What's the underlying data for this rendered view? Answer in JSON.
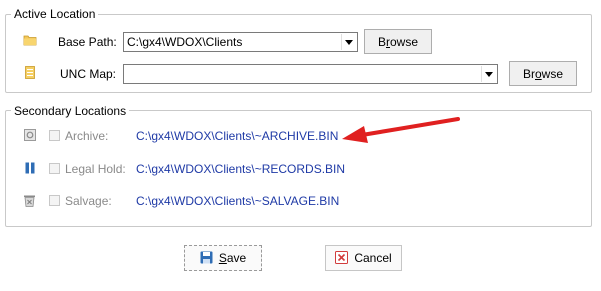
{
  "active_location": {
    "title": "Active Location",
    "base_path_label": "Base Path:",
    "base_path_value": "C:\\gx4\\WDOX\\Clients",
    "unc_map_label": "UNC Map:",
    "unc_map_value": "",
    "browse_prefix": "B",
    "browse_underlined": "r",
    "browse_suffix": "owse",
    "browse2_prefix": "Br",
    "browse2_underlined": "o",
    "browse2_suffix": "wse"
  },
  "secondary_locations": {
    "title": "Secondary Locations",
    "items": [
      {
        "label": "Archive:",
        "path": "C:\\gx4\\WDOX\\Clients\\~ARCHIVE.BIN",
        "checked": false,
        "icon": "archive-icon"
      },
      {
        "label": "Legal Hold:",
        "path": "C:\\gx4\\WDOX\\Clients\\~RECORDS.BIN",
        "checked": false,
        "icon": "legal-hold-icon"
      },
      {
        "label": "Salvage:",
        "path": "C:\\gx4\\WDOX\\Clients\\~SALVAGE.BIN",
        "checked": false,
        "icon": "salvage-icon"
      }
    ]
  },
  "buttons": {
    "save_underlined": "S",
    "save_rest": "ave",
    "cancel": "Cancel"
  },
  "colors": {
    "path_text": "#1f3aa6",
    "annotation_arrow": "#e02020"
  }
}
